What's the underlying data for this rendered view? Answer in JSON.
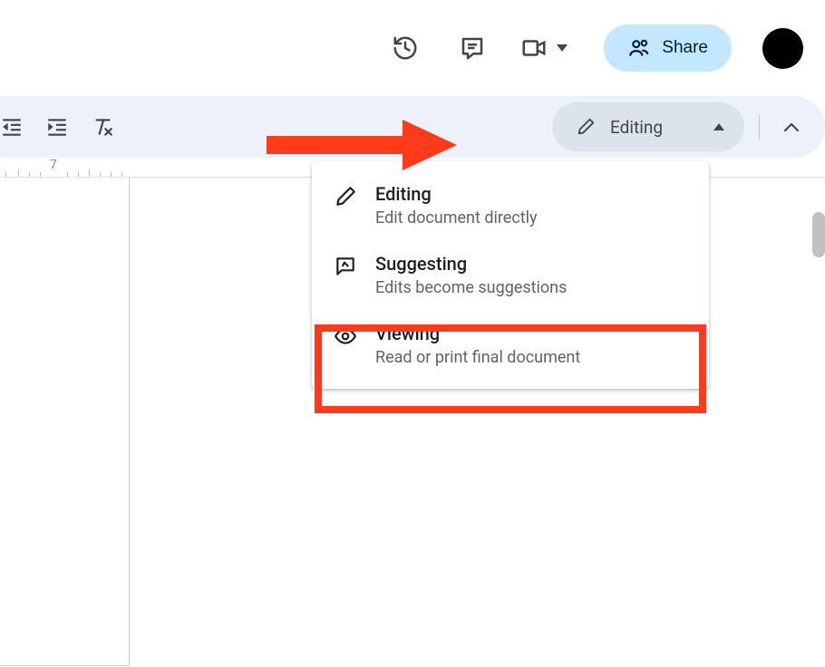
{
  "header": {
    "share_label": "Share"
  },
  "toolbar": {
    "mode_label": "Editing"
  },
  "ruler": {
    "number": "7"
  },
  "mode_menu": {
    "items": [
      {
        "title": "Editing",
        "desc": "Edit document directly"
      },
      {
        "title": "Suggesting",
        "desc": "Edits become suggestions"
      },
      {
        "title": "Viewing",
        "desc": "Read or print final document"
      }
    ]
  },
  "annotation": {
    "highlighted_index": 2
  }
}
